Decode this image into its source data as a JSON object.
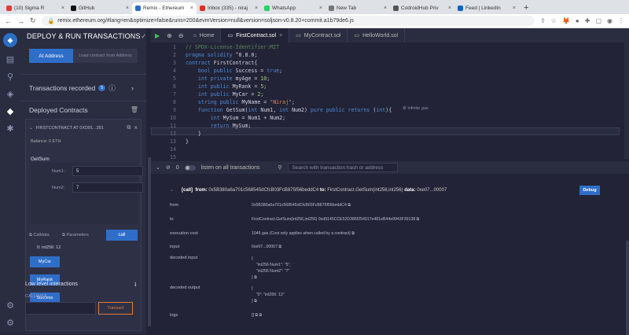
{
  "browser": {
    "tabs": [
      {
        "label": "(10) Sigma R",
        "color": "#e53935"
      },
      {
        "label": "GitHub",
        "color": "#111111"
      },
      {
        "label": "Remix - Ethereum",
        "color": "#2b6fc4",
        "active": true
      },
      {
        "label": "Inbox (335) - niraj",
        "color": "#d93025"
      },
      {
        "label": "WhatsApp",
        "color": "#25d366"
      },
      {
        "label": "New Tab",
        "color": "#777777"
      },
      {
        "label": "CodroidHub Priv",
        "color": "#555555"
      },
      {
        "label": "Feed | LinkedIn",
        "color": "#0a66c2"
      }
    ],
    "url": "remix.ethereum.org/#lang=en&optimize=false&runs=200&evmVersion=null&version=soljson-v0.8.20+commit.a1b79de6.js"
  },
  "side": {
    "title": "DEPLOY & RUN TRANSACTIONS",
    "at_address": "At Address",
    "load_contract": "Load contract from Address",
    "transactions_recorded": "Transactions recorded",
    "tx_count": "5",
    "deployed_contracts": "Deployed Contracts",
    "instance_name": "FIRSTCONTRACT AT 0XD91...391",
    "balance": "Balance: 0 ETH",
    "function_name": "GetSum",
    "param1_label": "Num1:",
    "param1_value": "5",
    "param2_label": "Num2:",
    "param2_value": "7",
    "calldata_label": "Calldata",
    "parameters_label": "Parameters",
    "call_button": "call",
    "result": "0: int256: 12",
    "buttons": [
      "MyCar",
      "MyRank",
      "Success"
    ],
    "low_level": "Low level interactions",
    "calldata_caption": "CALLDATA",
    "transact_button": "Transact"
  },
  "editor": {
    "tabs": [
      "Home",
      "FirstContract.sol",
      "MyContract.sol",
      "HelloWorld.sol"
    ],
    "active_tab": "FirstContract.sol",
    "gas_hint": "infinite gas",
    "line_numbers": [
      "1",
      "2",
      "3",
      "4",
      "5",
      "6",
      "7",
      "8",
      "9",
      "10",
      "11",
      "12",
      "13",
      "14",
      "15"
    ]
  },
  "terminal": {
    "count": "0",
    "listen_label": "listen on all transactions",
    "search_placeholder": "Search with transaction hash or address",
    "log_prefix": "[call]",
    "log_from_label": "from:",
    "log_from": "0x5B380a6a701c568545dCfcB03FcB875f56beddC4",
    "log_to_label": "to:",
    "log_to": "FirstContract.GetSum(int256,int256)",
    "log_data_label": "data:",
    "log_data": "0xe07...00007",
    "debug_button": "Debug",
    "rows": [
      {
        "key": "from",
        "value": "0x5B380a6a701c568545dCfcB03FcB875f56beddC4"
      },
      {
        "key": "to",
        "value": "FirstContract.GetSum(int256,int256) 0xd9145CCE52D386f254917e481eB44e9943F39138"
      },
      {
        "key": "execution cost",
        "value": "1046 gas (Cost only applies when called by a contract)"
      },
      {
        "key": "input",
        "value": "0xe07...00007"
      },
      {
        "key": "decoded input",
        "value": "{\n    \"int256 Num1\": \"5\",\n    \"int256 Num2\": \"7\"\n}"
      },
      {
        "key": "decoded output",
        "value": "{\n    \"0\": \"int256: 12\"\n}"
      },
      {
        "key": "logs",
        "value": "[]"
      }
    ]
  }
}
